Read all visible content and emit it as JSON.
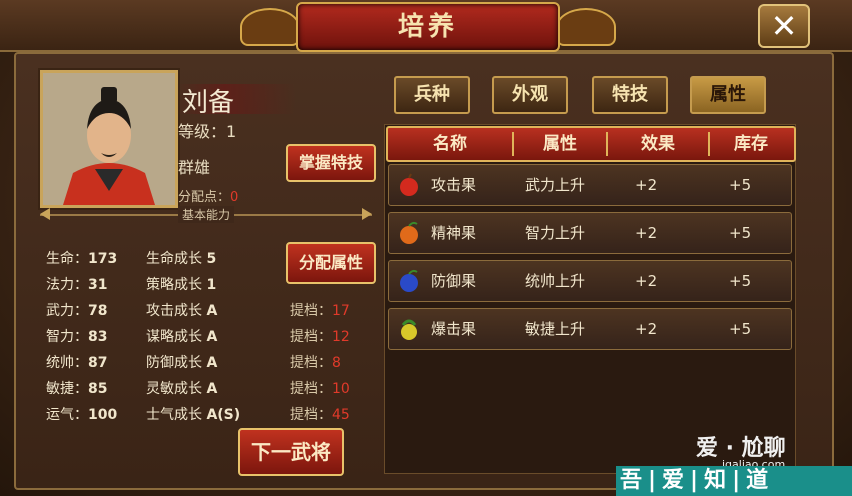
{
  "window": {
    "title": "培养",
    "close_label": "✕"
  },
  "hero": {
    "name": "刘备",
    "level_label": "等级：1",
    "faction": "群雄",
    "alloc_label": "分配点：",
    "alloc_value": "0",
    "master_skill_button": "掌握特技",
    "section_label": "基本能力",
    "alloc_attr_button": "分配属性",
    "next_hero_button": "下一武将"
  },
  "stats": [
    {
      "label": "生命：",
      "value": "173",
      "growth_label": "生命成长",
      "growth": "5",
      "tier_label": "",
      "tier": ""
    },
    {
      "label": "法力：",
      "value": "31",
      "growth_label": "策略成长",
      "growth": "1",
      "tier_label": "",
      "tier": ""
    },
    {
      "label": "武力：",
      "value": "78",
      "growth_label": "攻击成长",
      "growth": "A",
      "tier_label": "提档：",
      "tier": "17"
    },
    {
      "label": "智力：",
      "value": "83",
      "growth_label": "谋略成长",
      "growth": "A",
      "tier_label": "提档：",
      "tier": "12"
    },
    {
      "label": "统帅：",
      "value": "87",
      "growth_label": "防御成长",
      "growth": "A",
      "tier_label": "提档：",
      "tier": "8"
    },
    {
      "label": "敏捷：",
      "value": "85",
      "growth_label": "灵敏成长",
      "growth": "A",
      "tier_label": "提档：",
      "tier": "10"
    },
    {
      "label": "运气：",
      "value": "100",
      "growth_label": "士气成长",
      "growth": "A(S)",
      "tier_label": "提档：",
      "tier": "45"
    }
  ],
  "tabs": [
    {
      "label": "兵种",
      "active": false
    },
    {
      "label": "外观",
      "active": false
    },
    {
      "label": "特技",
      "active": false
    },
    {
      "label": "属性",
      "active": true
    }
  ],
  "table": {
    "headers": [
      "名称",
      "属性",
      "效果",
      "库存"
    ],
    "rows": [
      {
        "icon": "red-fruit-icon",
        "name": "攻击果",
        "attr": "武力上升",
        "effect": "+2",
        "stock": "+5"
      },
      {
        "icon": "orange-fruit-icon",
        "name": "精神果",
        "attr": "智力上升",
        "effect": "+2",
        "stock": "+5"
      },
      {
        "icon": "blue-fruit-icon",
        "name": "防御果",
        "attr": "统帅上升",
        "effect": "+2",
        "stock": "+5"
      },
      {
        "icon": "yellow-fruit-icon",
        "name": "爆击果",
        "attr": "敏捷上升",
        "effect": "+2",
        "stock": "+5"
      }
    ]
  },
  "watermark": {
    "top": "爱 · 尬聊",
    "url": "igaliao.com",
    "bar": "吾|爱|知|道"
  }
}
